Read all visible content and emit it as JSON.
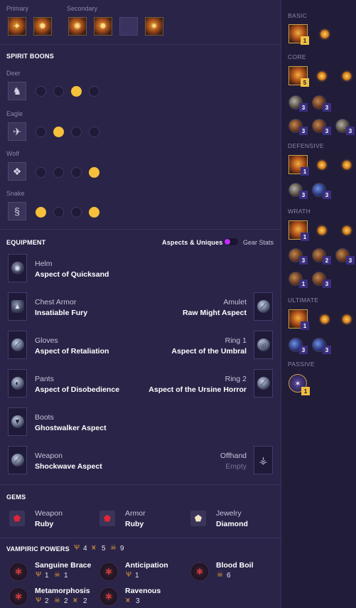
{
  "top": {
    "primary_label": "Primary",
    "secondary_label": "Secondary"
  },
  "spirit_boons": {
    "title": "SPIRIT BOONS",
    "groups": [
      {
        "name": "Deer",
        "icon": "deer-icon",
        "active": [
          false,
          false,
          true,
          false
        ]
      },
      {
        "name": "Eagle",
        "icon": "eagle-icon",
        "active": [
          false,
          true,
          false,
          false
        ]
      },
      {
        "name": "Wolf",
        "icon": "wolf-icon",
        "active": [
          false,
          false,
          false,
          true
        ]
      },
      {
        "name": "Snake",
        "icon": "snake-icon",
        "active": [
          true,
          false,
          false,
          true
        ]
      }
    ]
  },
  "equipment": {
    "title": "EQUIPMENT",
    "toggle_left": "Aspects & Uniques",
    "toggle_right": "Gear Stats",
    "items": [
      {
        "slot": "Helm",
        "aspect": "Aspect of Quicksand",
        "side": "left"
      },
      {
        "slot": "Chest Armor",
        "aspect": "Insatiable Fury",
        "side": "left"
      },
      {
        "slot": "Amulet",
        "aspect": "Raw Might Aspect",
        "side": "right"
      },
      {
        "slot": "Gloves",
        "aspect": "Aspect of Retaliation",
        "side": "left"
      },
      {
        "slot": "Ring 1",
        "aspect": "Aspect of the Umbral",
        "side": "right"
      },
      {
        "slot": "Pants",
        "aspect": "Aspect of Disobedience",
        "side": "left"
      },
      {
        "slot": "Ring 2",
        "aspect": "Aspect of the Ursine Horror",
        "side": "right"
      },
      {
        "slot": "Boots",
        "aspect": "Ghostwalker Aspect",
        "side": "left"
      },
      {
        "slot": "Weapon",
        "aspect": "Shockwave Aspect",
        "side": "left"
      },
      {
        "slot": "Offhand",
        "aspect": "Empty",
        "side": "right"
      }
    ]
  },
  "gems": {
    "title": "GEMS",
    "items": [
      {
        "slot": "Weapon",
        "gem": "Ruby"
      },
      {
        "slot": "Armor",
        "gem": "Ruby"
      },
      {
        "slot": "Jewelry",
        "gem": "Diamond"
      }
    ]
  },
  "vampiric": {
    "title": "VAMPIRIC POWERS",
    "totals": [
      "4",
      "5",
      "9"
    ],
    "powers": [
      {
        "name": "Sanguine Brace",
        "stats": [
          "1",
          "1"
        ]
      },
      {
        "name": "Anticipation",
        "stats": [
          "1"
        ]
      },
      {
        "name": "Blood Boil",
        "stats": [
          "6"
        ]
      },
      {
        "name": "Metamorphosis",
        "stats": [
          "2",
          "2",
          "2"
        ]
      },
      {
        "name": "Ravenous",
        "stats": [
          "3"
        ]
      }
    ]
  },
  "skill_tree": {
    "basic": {
      "label": "BASIC",
      "rank": "1"
    },
    "core": {
      "label": "CORE",
      "rank": "5",
      "nodes": [
        "3",
        "3",
        "3",
        "3",
        "3"
      ]
    },
    "defensive": {
      "label": "DEFENSIVE",
      "rank": "1",
      "nodes": [
        "3",
        "3"
      ]
    },
    "wrath": {
      "label": "WRATH",
      "rank": "1",
      "nodes": [
        "3",
        "2",
        "3",
        "1",
        "3"
      ]
    },
    "ultimate": {
      "label": "ULTIMATE",
      "rank": "1",
      "nodes": [
        "3",
        "3"
      ]
    },
    "passive": {
      "label": "PASSIVE",
      "rank": "1"
    }
  },
  "colors": {
    "accent": "#f5c13b",
    "toggle": "#c02cff",
    "background": "#2a2448"
  }
}
